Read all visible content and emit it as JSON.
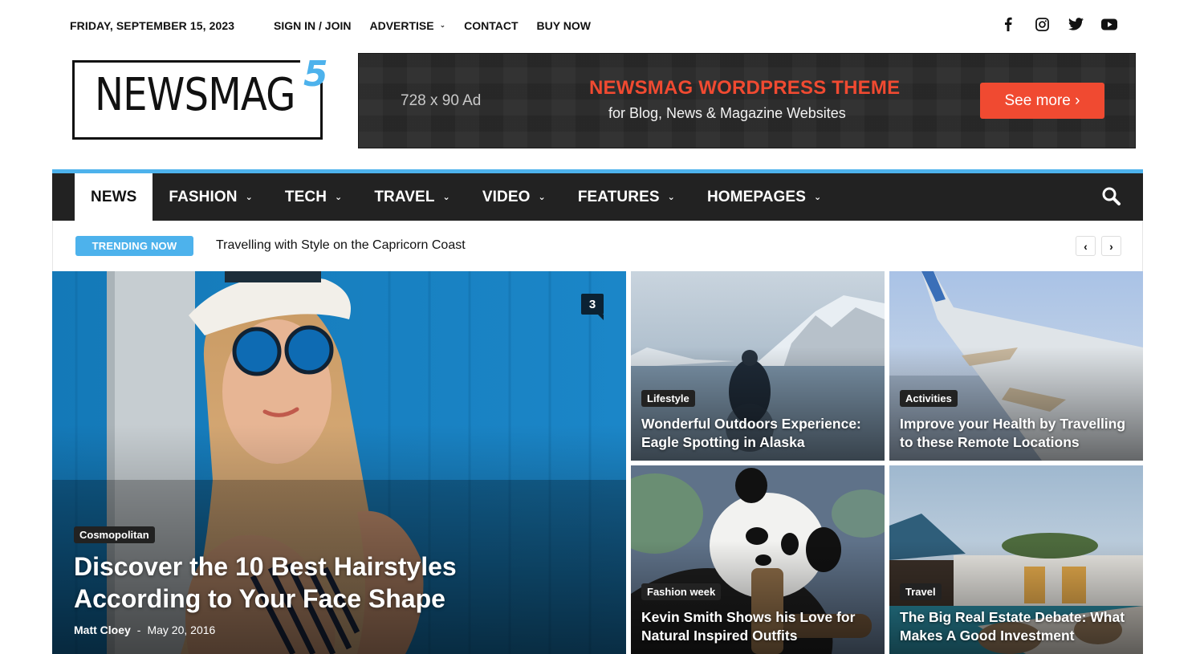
{
  "topbar": {
    "date": "FRIDAY, SEPTEMBER 15, 2023",
    "links": [
      {
        "label": "SIGN IN / JOIN",
        "dropdown": false
      },
      {
        "label": "ADVERTISE",
        "dropdown": true
      },
      {
        "label": "CONTACT",
        "dropdown": false
      },
      {
        "label": "BUY NOW",
        "dropdown": false
      }
    ],
    "socials": [
      "facebook-icon",
      "instagram-icon",
      "twitter-icon",
      "youtube-icon"
    ]
  },
  "logo": {
    "text": "NEWSMAG",
    "superscript": "5",
    "accent_color": "#4db2ec"
  },
  "ad": {
    "size_label": "728 x 90 Ad",
    "title": "NEWSMAG WORDPRESS THEME",
    "subtitle": "for Blog, News & Magazine Websites",
    "button_label": "See more ›",
    "accent_color": "#f04a31"
  },
  "menu": {
    "items": [
      {
        "label": "NEWS",
        "dropdown": false,
        "active": true
      },
      {
        "label": "FASHION",
        "dropdown": true,
        "active": false
      },
      {
        "label": "TECH",
        "dropdown": true,
        "active": false
      },
      {
        "label": "TRAVEL",
        "dropdown": true,
        "active": false
      },
      {
        "label": "VIDEO",
        "dropdown": true,
        "active": false
      },
      {
        "label": "FEATURES",
        "dropdown": true,
        "active": false
      },
      {
        "label": "HOMEPAGES",
        "dropdown": true,
        "active": false
      }
    ],
    "chevron": "⌄"
  },
  "trending": {
    "badge": "TRENDING NOW",
    "headline": "Travelling with Style on the Capricorn Coast",
    "prev": "‹",
    "next": "›"
  },
  "featured": {
    "category": "Cosmopolitan",
    "title": "Discover the 10 Best Hairstyles According to Your Face Shape",
    "author": "Matt Cloey",
    "separator": "-",
    "date": "May 20, 2016",
    "comments": "3"
  },
  "tiles": [
    {
      "category": "Lifestyle",
      "title": "Wonderful Outdoors Experience: Eagle Spotting in Alaska"
    },
    {
      "category": "Activities",
      "title": "Improve your Health by Travelling to these Remote Locations"
    },
    {
      "category": "Fashion week",
      "title": "Kevin Smith Shows his Love for Natural Inspired Outfits"
    },
    {
      "category": "Travel",
      "title": "The Big Real Estate Debate: What Makes A Good Investment"
    }
  ]
}
